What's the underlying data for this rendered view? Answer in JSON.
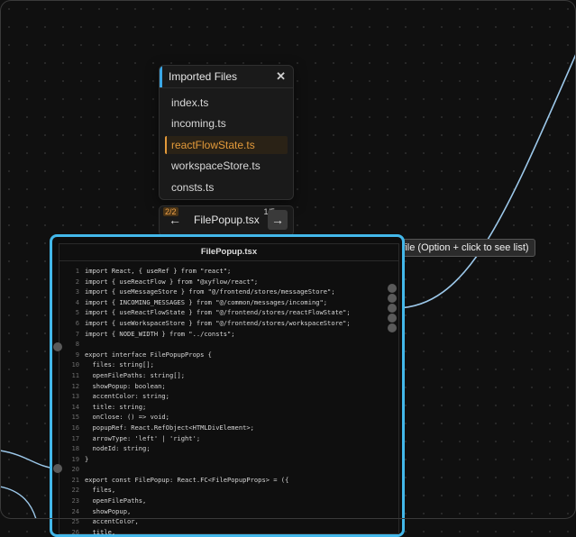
{
  "popup": {
    "title": "Imported Files",
    "close_icon": "close-icon",
    "files": [
      "index.ts",
      "incoming.ts",
      "reactFlowState.ts",
      "workspaceStore.ts",
      "consts.ts"
    ],
    "active_index": 2
  },
  "nav": {
    "prev_count": "2/2",
    "label": "FilePopup.tsx",
    "next_count": "1/5",
    "prev_icon": "arrow-left-icon",
    "next_icon": "arrow-right-icon"
  },
  "tooltip": "Open files imported by this file (Option + click to see list)",
  "node": {
    "title": "FilePopup.tsx",
    "border_color": "#43b8ea",
    "lines": [
      {
        "n": "1",
        "t": "import React, { useRef } from \"react\";"
      },
      {
        "n": "2",
        "t": "import { useReactFlow } from \"@xyflow/react\";"
      },
      {
        "n": "3",
        "t": "import { useMessageStore } from \"@/frontend/stores/messageStore\";"
      },
      {
        "n": "4",
        "t": "import { INCOMING_MESSAGES } from \"@/common/messages/incoming\";"
      },
      {
        "n": "5",
        "t": "import { useReactFlowState } from \"@/frontend/stores/reactFlowState\";"
      },
      {
        "n": "6",
        "t": "import { useWorkspaceStore } from \"@/frontend/stores/workspaceStore\";"
      },
      {
        "n": "7",
        "t": "import { NODE_WIDTH } from \"../consts\";"
      },
      {
        "n": "8",
        "t": ""
      },
      {
        "n": "9",
        "t": "export interface FilePopupProps {"
      },
      {
        "n": "10",
        "t": "  files: string[];"
      },
      {
        "n": "11",
        "t": "  openFilePaths: string[];"
      },
      {
        "n": "12",
        "t": "  showPopup: boolean;"
      },
      {
        "n": "13",
        "t": "  accentColor: string;"
      },
      {
        "n": "14",
        "t": "  title: string;"
      },
      {
        "n": "15",
        "t": "  onClose: () => void;"
      },
      {
        "n": "16",
        "t": "  popupRef: React.RefObject<HTMLDivElement>;"
      },
      {
        "n": "17",
        "t": "  arrowType: 'left' | 'right';"
      },
      {
        "n": "18",
        "t": "  nodeId: string;"
      },
      {
        "n": "19",
        "t": "}"
      },
      {
        "n": "20",
        "t": ""
      },
      {
        "n": "21",
        "t": "export const FilePopup: React.FC<FilePopupProps> = ({"
      },
      {
        "n": "22",
        "t": "  files,"
      },
      {
        "n": "23",
        "t": "  openFilePaths,"
      },
      {
        "n": "24",
        "t": "  showPopup,"
      },
      {
        "n": "25",
        "t": "  accentColor,"
      },
      {
        "n": "26",
        "t": "  title,"
      }
    ]
  }
}
